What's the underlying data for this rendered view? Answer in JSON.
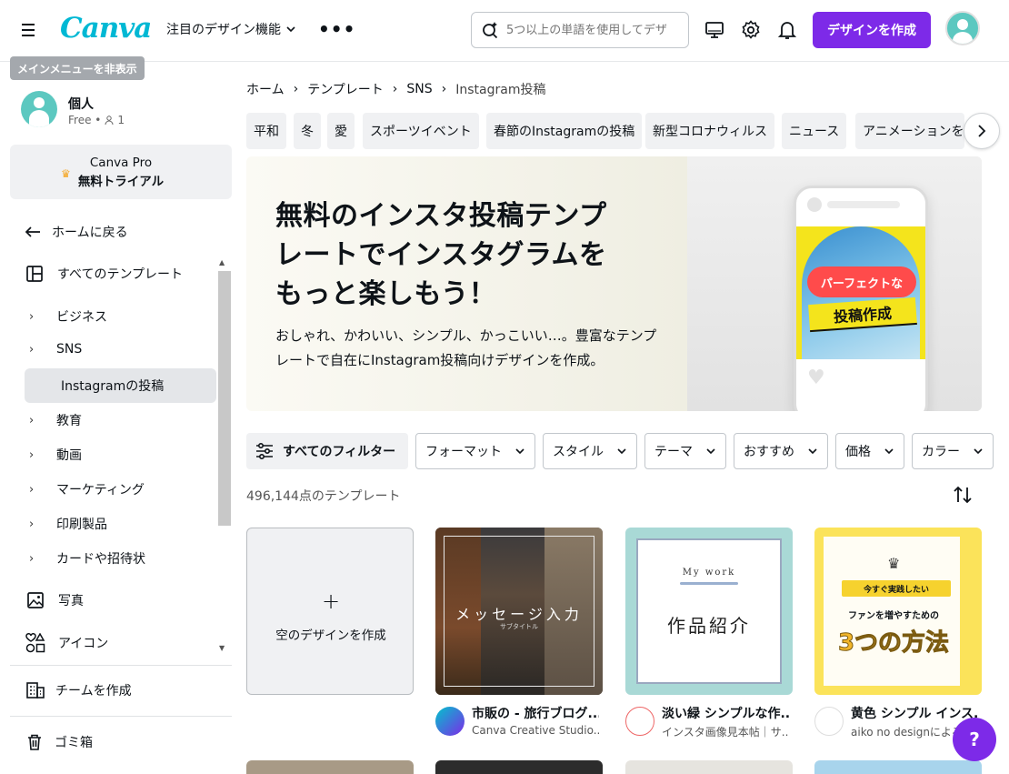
{
  "header": {
    "logo": "Canva",
    "feature_menu": "注目のデザイン機能",
    "search_placeholder": "5つ以上の単語を使用してデザ",
    "create_button": "デザインを作成",
    "tooltip": "メインメニューを非表示",
    "icons": [
      "menu-icon",
      "search-sparkle-icon",
      "desktop-icon",
      "gear-icon",
      "bell-icon",
      "chevron-down-icon",
      "more-icon"
    ]
  },
  "sidebar": {
    "profile_name": "個人",
    "profile_plan": "Free •",
    "profile_members": "1",
    "pro_line1": "Canva Pro",
    "pro_line2": "無料トライアル",
    "back_home": "ホームに戻る",
    "all_templates": "すべてのテンプレート",
    "items": [
      {
        "label": "ビジネス"
      },
      {
        "label": "SNS"
      },
      {
        "label": "Instagramの投稿"
      },
      {
        "label": "教育"
      },
      {
        "label": "動画"
      },
      {
        "label": "マーケティング"
      },
      {
        "label": "印刷製品"
      },
      {
        "label": "カードや招待状"
      }
    ],
    "photos": "写真",
    "icons_label": "アイコン",
    "team": "チームを作成",
    "trash": "ゴミ箱"
  },
  "breadcrumb": [
    "ホーム",
    "テンプレート",
    "SNS",
    "Instagram投稿"
  ],
  "chips": [
    "平和",
    "冬",
    "愛",
    "スポーツイベント",
    "春節のInstagramの投稿",
    "新型コロナウィルス",
    "ニュース",
    "アニメーションを"
  ],
  "hero": {
    "title": "無料のインスタ投稿テンプレートでインスタグラムをもっと楽しもう！",
    "subtitle": "おしゃれ、かわいい、シンプル、かっこいい…。豊富なテンプレートで自在にInstagram投稿向けデザインを作成。",
    "badge_line1": "パーフェクトな",
    "badge_line2": "投稿作成"
  },
  "filters": {
    "all": "すべてのフィルター",
    "items": [
      "フォーマット",
      "スタイル",
      "テーマ",
      "おすすめ",
      "価格",
      "カラー"
    ]
  },
  "results_count": "496,144点のテンプレート",
  "templates": {
    "blank_label": "空のデザインを作成",
    "cards": [
      {
        "title": "市販の - 旅行ブログ...",
        "creator": "Canva Creative Studio...",
        "overlay_text": "メッセージ入力",
        "overlay_sub": "サブタイトル"
      },
      {
        "title": "淡い緑 シンプルな作...",
        "creator": "インスタ画像見本帖｜サ...",
        "overlay_small": "My work",
        "overlay_text": "作品紹介"
      },
      {
        "title": "黄色 シンプル インス...",
        "creator": "aiko no designによる",
        "overlay_tag": "今すぐ実践したい",
        "overlay_sub": "ファンを増やすための",
        "overlay_text": "3つの方法"
      }
    ]
  },
  "help_label": "?",
  "colors": {
    "accent": "#7d2ae8",
    "brand": "#00c4cc",
    "chip_bg": "#f0f1f3"
  }
}
